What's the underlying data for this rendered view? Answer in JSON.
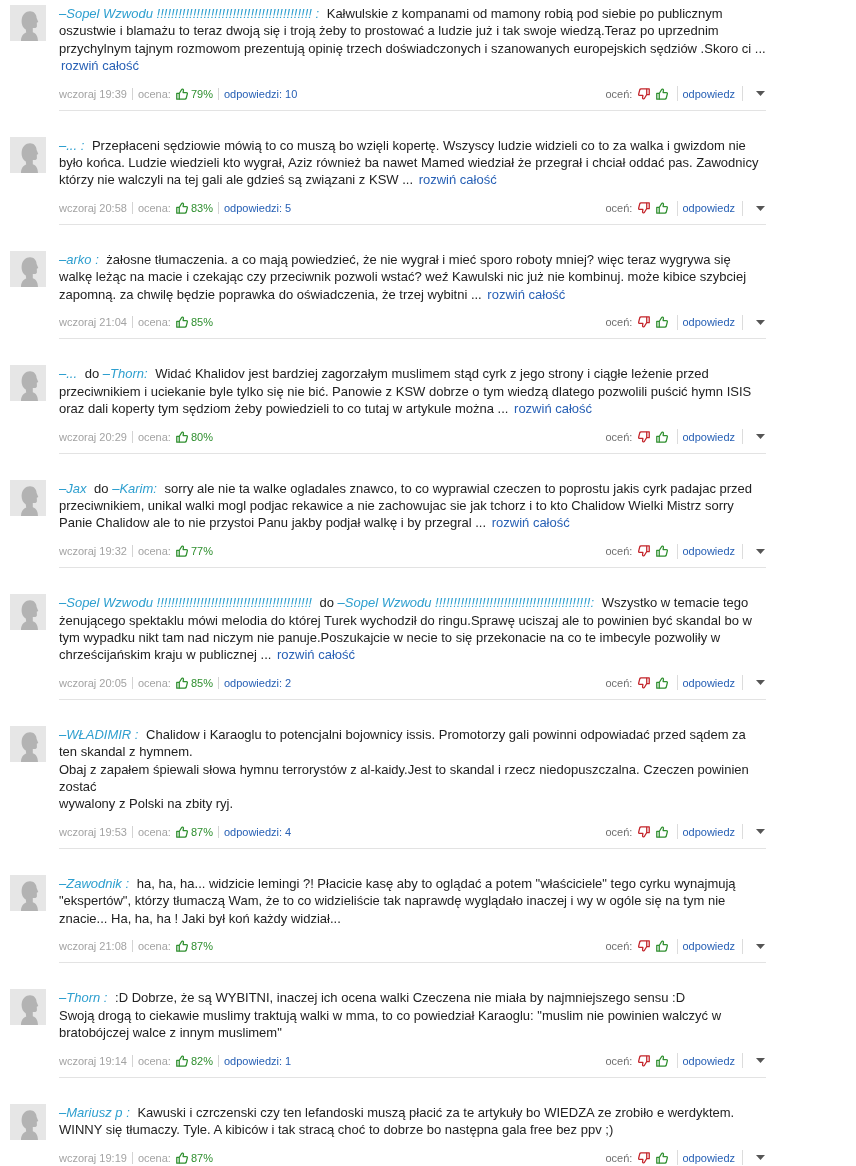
{
  "comments": [
    {
      "author": "–Sopel Wzwodu !!!!!!!!!!!!!!!!!!!!!!!!!!!!!!!!!!!!!!!!!!! :",
      "text": "Kałwulskie z kompanami od mamony robią pod siebie po publicznym oszustwie i blamażu to teraz dwoją się i troją żeby to prostować a ludzie już i tak swoje wiedzą.Teraz po uprzednim przychylnym tajnym rozmowom prezentują opinię trzech doświadczonych i szanowanych europejskich sędziów .Skoro ci ...",
      "more_link": "rozwiń całość",
      "time": "wczoraj 19:39",
      "rating_label": "ocena:",
      "rating": "79%",
      "replies": "odpowiedzi: 10",
      "rate_label": "oceń:",
      "reply_button": "odpowiedz"
    },
    {
      "author": "–... :",
      "text": "Przepłaceni sędziowie mówią to co muszą bo wzięli kopertę. Wszyscy ludzie widzieli co to za walka i gwizdom nie było końca. Ludzie wiedzieli kto wygrał, Aziz również ba nawet Mamed wiedział że przegrał i chciał oddać pas. Zawodnicy którzy nie walczyli na tej gali ale gdzieś są związani z KSW ...",
      "more_link": "rozwiń całość",
      "time": "wczoraj 20:58",
      "rating_label": "ocena:",
      "rating": "83%",
      "replies": "odpowiedzi: 5",
      "rate_label": "oceń:",
      "reply_button": "odpowiedz"
    },
    {
      "author": "–arko :",
      "text": "żałosne tłumaczenia. a co mają powiedzieć, że nie wygrał i mieć sporo roboty mniej? więc teraz wygrywa się walkę leżąc na macie i czekając czy przeciwnik pozwoli wstać? weź Kawulski nic już nie kombinuj. może kibice szybciej zapomną. za chwilę będzie poprawka do oświadczenia, że trzej wybitni ...",
      "more_link": "rozwiń całość",
      "time": "wczoraj 21:04",
      "rating_label": "ocena:",
      "rating": "85%",
      "rate_label": "oceń:",
      "reply_button": "odpowiedz"
    },
    {
      "author": "–...",
      "to_word": "do",
      "to_author": "–Thorn:",
      "text": "Widać Khalidov jest bardziej zagorzałym muslimem stąd cyrk z jego strony i ciągłe leżenie przed przeciwnikiem i uciekanie byle tylko się nie bić. Panowie z KSW dobrze o tym wiedzą dlatego pozwolili puścić hymn ISIS oraz dali koperty tym sędziom żeby powiedzieli to co tutaj w artykule można ...",
      "more_link": "rozwiń całość",
      "time": "wczoraj 20:29",
      "rating_label": "ocena:",
      "rating": "80%",
      "rate_label": "oceń:",
      "reply_button": "odpowiedz"
    },
    {
      "author": "–Jax",
      "to_word": "do",
      "to_author": "–Karim:",
      "text": "sorry ale nie ta walke ogladales znawco, to co wyprawial czeczen to poprostu jakis cyrk padajac przed przeciwnikiem, unikal walki mogl podjac rekawice a nie zachowujac sie jak tchorz i to kto Chalidow Wielki Mistrz sorry Panie Chalidow ale to nie przystoi Panu jakby podjał walkę i by przegral ...",
      "more_link": "rozwiń całość",
      "time": "wczoraj 19:32",
      "rating_label": "ocena:",
      "rating": "77%",
      "rate_label": "oceń:",
      "reply_button": "odpowiedz"
    },
    {
      "author": "–Sopel Wzwodu !!!!!!!!!!!!!!!!!!!!!!!!!!!!!!!!!!!!!!!!!!!",
      "to_word": "do",
      "to_author": "–Sopel Wzwodu !!!!!!!!!!!!!!!!!!!!!!!!!!!!!!!!!!!!!!!!!!!:",
      "text": "Wszystko w temacie tego żenującego spektaklu mówi melodia do której Turek wychodził do ringu.Sprawę uciszaj ale to powinien być skandal bo w tym wypadku nikt tam nad niczym nie panuje.Poszukajcie w necie to się przekonacie na co te imbecyle pozwoliły w chrześcijańskim kraju w publicznej ...",
      "more_link": "rozwiń całość",
      "time": "wczoraj 20:05",
      "rating_label": "ocena:",
      "rating": "85%",
      "replies": "odpowiedzi: 2",
      "rate_label": "oceń:",
      "reply_button": "odpowiedz"
    },
    {
      "author": "–WŁADIMIR :",
      "text": "Chalidow i Karaoglu to potencjalni bojownicy issis. Promotorzy gali powinni odpowiadać przed sądem za ten skandal z hymnem.\nObaj z zapałem śpiewali słowa hymnu terrorystów z al-kaidy.Jest to skandal i rzecz niedopuszczalna. Czeczen powinien zostać\nwywalony z Polski na zbity ryj.",
      "time": "wczoraj 19:53",
      "rating_label": "ocena:",
      "rating": "87%",
      "replies": "odpowiedzi: 4",
      "rate_label": "oceń:",
      "reply_button": "odpowiedz"
    },
    {
      "author": "–Zawodnik :",
      "text": "ha, ha, ha... widzicie lemingi ?! Płacicie kasę aby to oglądać a potem \"właściciele\" tego cyrku wynajmują \"ekspertów\", którzy tłumaczą Wam, że to co widzieliście tak naprawdę wyglądało inaczej i wy w ogóle się na tym nie znacie... Ha, ha, ha ! Jaki był koń każdy widział...",
      "time": "wczoraj 21:08",
      "rating_label": "ocena:",
      "rating": "87%",
      "rate_label": "oceń:",
      "reply_button": "odpowiedz"
    },
    {
      "author": "–Thorn :",
      "text": ":D Dobrze, że są WYBITNI, inaczej ich ocena walki Czeczena nie miała by najmniejszego sensu :D\nSwoją drogą to ciekawie muslimy traktują walki w mma, to co powiedział Karaoglu: \"muslim nie powinien walczyć w bratobójczej walce z innym muslimem\"",
      "time": "wczoraj 19:14",
      "rating_label": "ocena:",
      "rating": "82%",
      "replies": "odpowiedzi: 1",
      "rate_label": "oceń:",
      "reply_button": "odpowiedz"
    },
    {
      "author": "–Mariusz p :",
      "text": "Kawuski i czrczenski czy ten lefandoski muszą płacić za te artykuły bo WIEDZA ze zrobiło e werdyktem. WINNY się tłumaczy. Tyle. A kibiców i tak stracą choć to dobrze bo następna gala free bez ppv ;)",
      "time": "wczoraj 19:19",
      "rating_label": "ocena:",
      "rating": "87%",
      "rate_label": "oceń:",
      "reply_button": "odpowiedz"
    }
  ]
}
